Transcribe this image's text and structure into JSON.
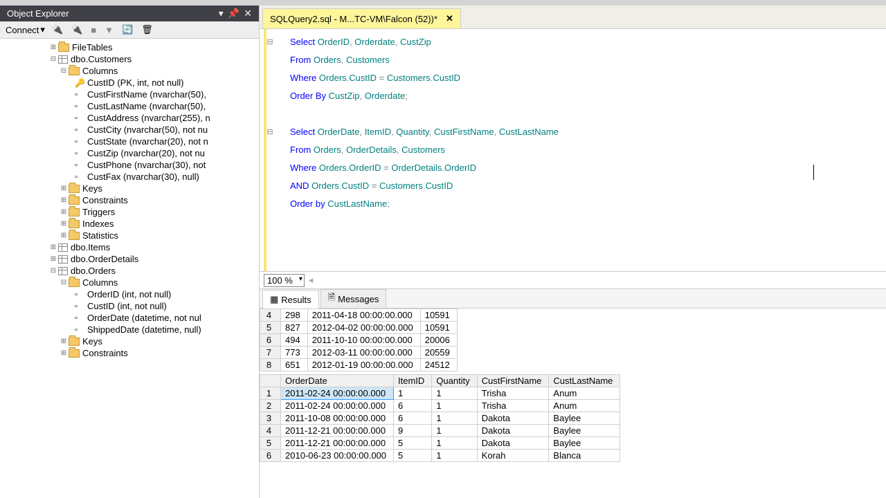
{
  "object_explorer": {
    "title": "Object Explorer",
    "connect_label": "Connect",
    "tree": {
      "filetables": "FileTables",
      "customers": {
        "label": "dbo.Customers",
        "columns_label": "Columns",
        "cols": [
          "CustID (PK, int, not null)",
          "CustFirstName (nvarchar(50),",
          "CustLastName (nvarchar(50),",
          "CustAddress (nvarchar(255), n",
          "CustCity (nvarchar(50), not nu",
          "CustState (nvarchar(20), not n",
          "CustZip (nvarchar(20), not nu",
          "CustPhone (nvarchar(30), not",
          "CustFax (nvarchar(30), null)"
        ],
        "keys": "Keys",
        "constraints": "Constraints",
        "triggers": "Triggers",
        "indexes": "Indexes",
        "statistics": "Statistics"
      },
      "items": "dbo.Items",
      "orderdetails": "dbo.OrderDetails",
      "orders": {
        "label": "dbo.Orders",
        "columns_label": "Columns",
        "cols": [
          "OrderID (int, not null)",
          "CustID (int, not null)",
          "OrderDate (datetime, not nul",
          "ShippedDate (datetime, null)"
        ],
        "keys": "Keys",
        "constraints": "Constraints"
      }
    }
  },
  "tab": {
    "title": "SQLQuery2.sql - M...TC-VM\\Falcon (52))*"
  },
  "zoom": {
    "value": "100 %"
  },
  "result_tabs": {
    "results": "Results",
    "messages": "Messages"
  },
  "grid1": {
    "rows": [
      [
        "4",
        "298",
        "2011-04-18 00:00:00.000",
        "10591"
      ],
      [
        "5",
        "827",
        "2012-04-02 00:00:00.000",
        "10591"
      ],
      [
        "6",
        "494",
        "2011-10-10 00:00:00.000",
        "20006"
      ],
      [
        "7",
        "773",
        "2012-03-11 00:00:00.000",
        "20559"
      ],
      [
        "8",
        "651",
        "2012-01-19 00:00:00.000",
        "24512"
      ]
    ]
  },
  "grid2": {
    "headers": [
      "",
      "OrderDate",
      "ItemID",
      "Quantity",
      "CustFirstName",
      "CustLastName"
    ],
    "rows": [
      [
        "1",
        "2011-02-24 00:00:00.000",
        "1",
        "1",
        "Trisha",
        "Anum"
      ],
      [
        "2",
        "2011-02-24 00:00:00.000",
        "6",
        "1",
        "Trisha",
        "Anum"
      ],
      [
        "3",
        "2011-10-08 00:00:00.000",
        "6",
        "1",
        "Dakota",
        "Baylee"
      ],
      [
        "4",
        "2011-12-21 00:00:00.000",
        "9",
        "1",
        "Dakota",
        "Baylee"
      ],
      [
        "5",
        "2011-12-21 00:00:00.000",
        "5",
        "1",
        "Dakota",
        "Baylee"
      ],
      [
        "6",
        "2010-06-23 00:00:00.000",
        "5",
        "1",
        "Korah",
        "Blanca"
      ]
    ]
  }
}
